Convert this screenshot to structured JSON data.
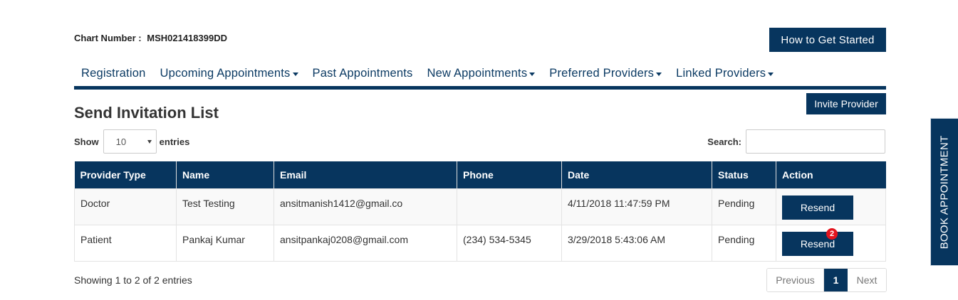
{
  "header": {
    "chart_number_label": "Chart Number :",
    "chart_number_value": "MSH021418399DD",
    "get_started_label": "How to Get Started"
  },
  "nav": {
    "items": [
      {
        "label": "Registration",
        "dropdown": false
      },
      {
        "label": "Upcoming Appointments",
        "dropdown": true
      },
      {
        "label": "Past Appointments",
        "dropdown": false
      },
      {
        "label": "New Appointments",
        "dropdown": true
      },
      {
        "label": "Preferred Providers",
        "dropdown": true
      },
      {
        "label": "Linked Providers",
        "dropdown": true
      }
    ]
  },
  "main": {
    "title": "Send Invitation List",
    "invite_label": "Invite Provider",
    "show_label": "Show",
    "entries_value": "10",
    "entries_label": "entries",
    "search_label": "Search:",
    "search_value": "",
    "columns": [
      "Provider Type",
      "Name",
      "Email",
      "Phone",
      "Date",
      "Status",
      "Action"
    ],
    "rows": [
      {
        "provider_type": "Doctor",
        "name": "Test Testing",
        "email": "ansitmanish1412@gmail.co",
        "phone": "",
        "date": "4/11/2018 11:47:59 PM",
        "status": "Pending",
        "action": "Resend",
        "badge": ""
      },
      {
        "provider_type": "Patient",
        "name": "Pankaj Kumar",
        "email": "ansitpankaj0208@gmail.com",
        "phone": "(234) 534-5345",
        "date": "3/29/2018 5:43:06 AM",
        "status": "Pending",
        "action": "Resend",
        "badge": "2"
      }
    ],
    "info_text": "Showing 1 to 2 of 2 entries",
    "pagination": {
      "previous": "Previous",
      "current": "1",
      "next": "Next"
    }
  },
  "side_tab": {
    "label": "BOOK APPOINTMENT"
  },
  "colors": {
    "primary": "#07355e",
    "badge": "#e3141e"
  }
}
